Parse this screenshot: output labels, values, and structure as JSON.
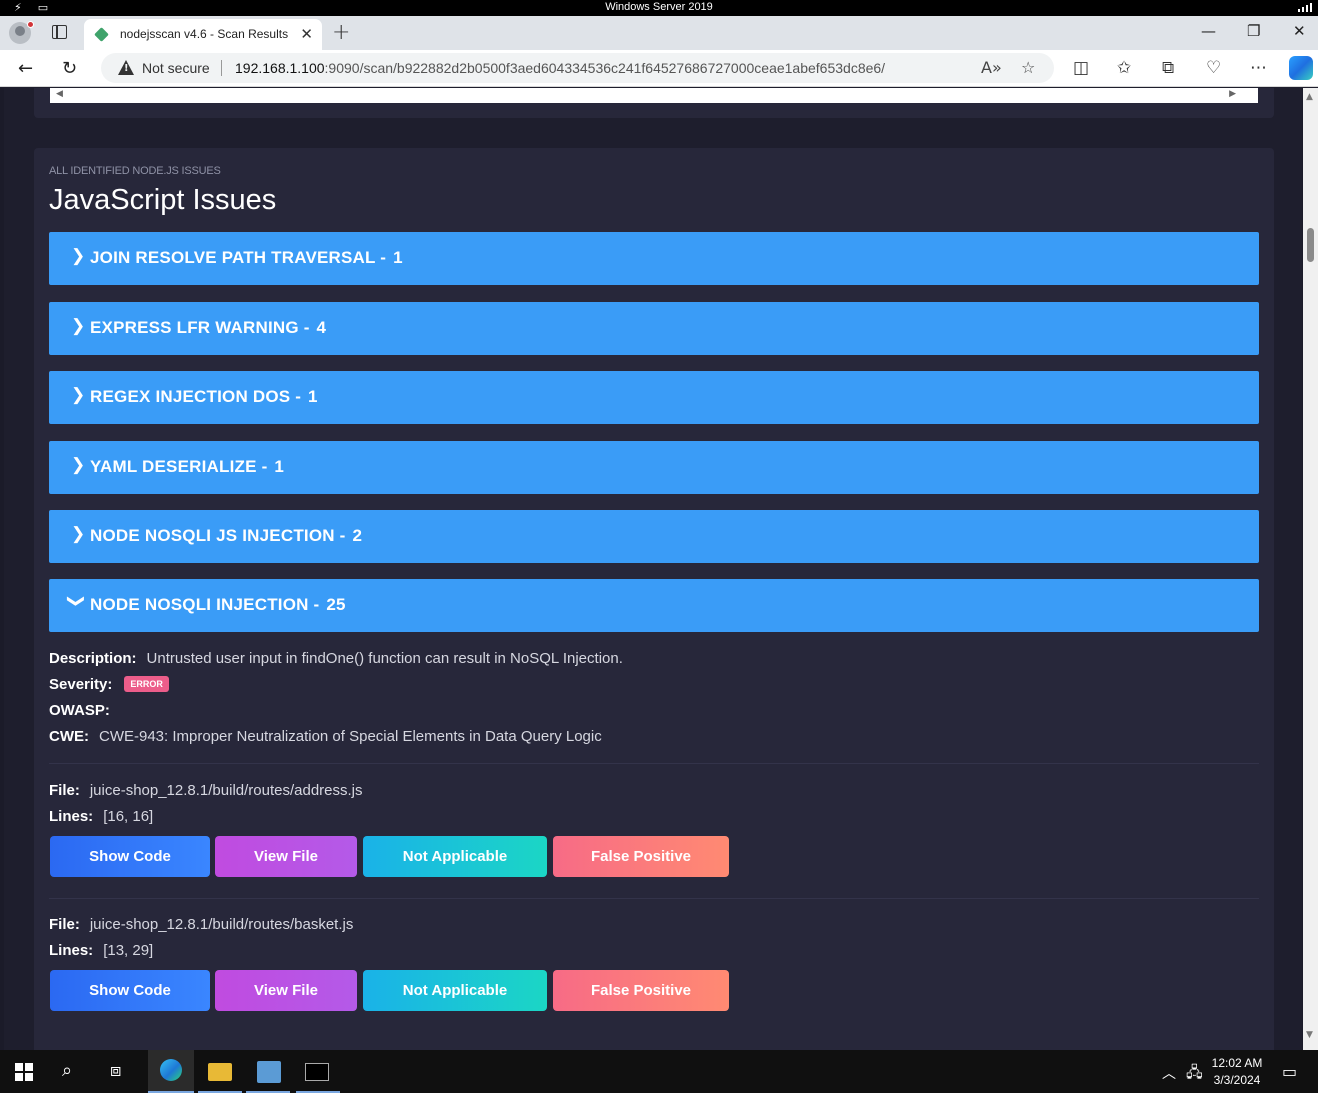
{
  "rdp": {
    "title": "Windows Server 2019"
  },
  "browser": {
    "tab_title": "nodejsscan v4.6 - Scan Results",
    "not_secure": "Not secure",
    "url_host": "192.168.1.100",
    "url_rest": ":9090/scan/b922882d2b0500f3aed604334536c241f64527686727000ceae1abef653dc8e6/"
  },
  "section": {
    "subtitle": "ALL IDENTIFIED NODE.JS ISSUES",
    "title": "JavaScript Issues"
  },
  "issues": [
    {
      "name": "JOIN RESOLVE PATH TRAVERSAL",
      "sep": "-",
      "count": "1",
      "expanded": false
    },
    {
      "name": "EXPRESS LFR WARNING",
      "sep": "-",
      "count": "4",
      "expanded": false
    },
    {
      "name": "REGEX INJECTION DOS",
      "sep": "-",
      "count": "1",
      "expanded": false
    },
    {
      "name": "YAML DESERIALIZE",
      "sep": "-",
      "count": "1",
      "expanded": false
    },
    {
      "name": "NODE NOSQLI JS INJECTION",
      "sep": "-",
      "count": "2",
      "expanded": false
    },
    {
      "name": "NODE NOSQLI INJECTION",
      "sep": "-",
      "count": "25",
      "expanded": true
    }
  ],
  "detail": {
    "description_label": "Description:",
    "description": "Untrusted user input in findOne() function can result in NoSQL Injection.",
    "severity_label": "Severity:",
    "severity": "ERROR",
    "owasp_label": "OWASP:",
    "owasp": "",
    "cwe_label": "CWE:",
    "cwe": "CWE-943: Improper Neutralization of Special Elements in Data Query Logic"
  },
  "files": [
    {
      "file_label": "File:",
      "file": "juice-shop_12.8.1/build/routes/address.js",
      "lines_label": "Lines:",
      "lines": "[16, 16]"
    },
    {
      "file_label": "File:",
      "file": "juice-shop_12.8.1/build/routes/basket.js",
      "lines_label": "Lines:",
      "lines": "[13, 29]"
    }
  ],
  "buttons": {
    "show_code": "Show Code",
    "view_file": "View File",
    "not_applicable": "Not Applicable",
    "false_positive": "False Positive"
  },
  "taskbar": {
    "time": "12:02 AM",
    "date": "3/3/2024"
  },
  "colors": {
    "issue_bar": "#3a9cf7",
    "card_bg": "#27273a",
    "page_bg": "#1e1e2d",
    "severity_badge": "#ec5d8a"
  }
}
